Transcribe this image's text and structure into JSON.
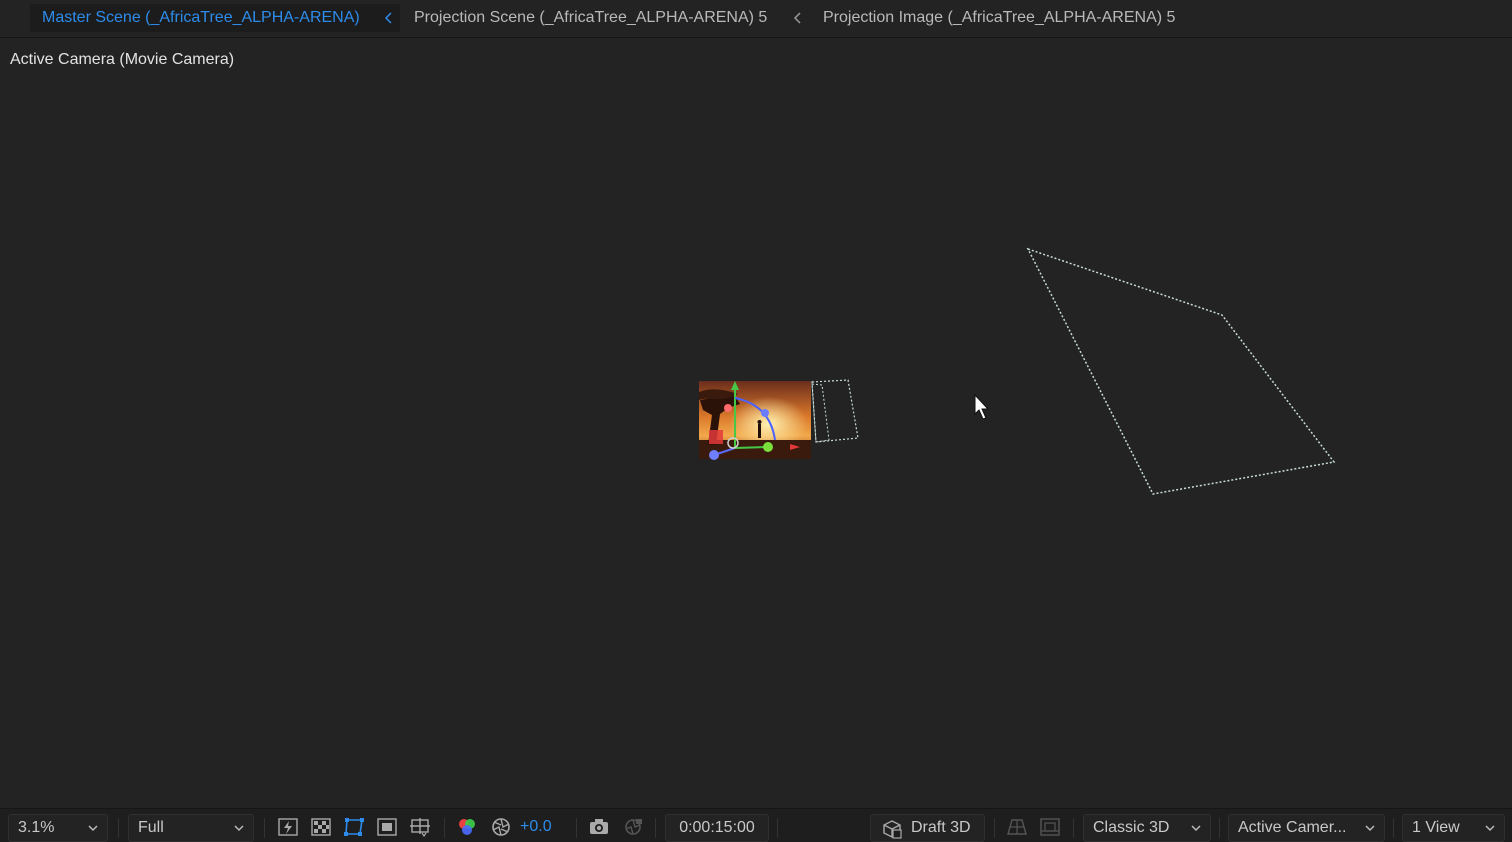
{
  "breadcrumbs": [
    {
      "label": "Master Scene (_AfricaTree_ALPHA-ARENA)",
      "active": true
    },
    {
      "label": "Projection Scene (_AfricaTree_ALPHA-ARENA) 5",
      "active": false
    },
    {
      "label": "Projection Image (_AfricaTree_ALPHA-ARENA) 5",
      "active": false
    }
  ],
  "viewport": {
    "view_label": "Active Camera (Movie Camera)"
  },
  "toolbar": {
    "magnification": "3.1%",
    "resolution": "Full",
    "exposure": "+0.0",
    "timecode": "0:00:15:00",
    "renderer_button": "Draft 3D",
    "renderer_menu": "Classic 3D",
    "view_menu": "Active Camer...",
    "layout_menu": "1 View"
  },
  "icons": {
    "fast_previews": "lightning-icon",
    "transparency_grid": "checkerboard-icon",
    "mask_visibility": "mask-path-icon",
    "region_of_interest": "region-of-interest-icon",
    "grid_guides": "grid-guides-icon",
    "channels": "rgb-channels-icon",
    "reset_exposure": "exposure-reset-icon",
    "snapshot": "camera-icon",
    "show_snapshot": "show-snapshot-icon",
    "draft3d": "cube-icon"
  },
  "colors": {
    "accent": "#2d8ceb",
    "background": "#232323",
    "frustum_outline": "#c8dcd8"
  }
}
